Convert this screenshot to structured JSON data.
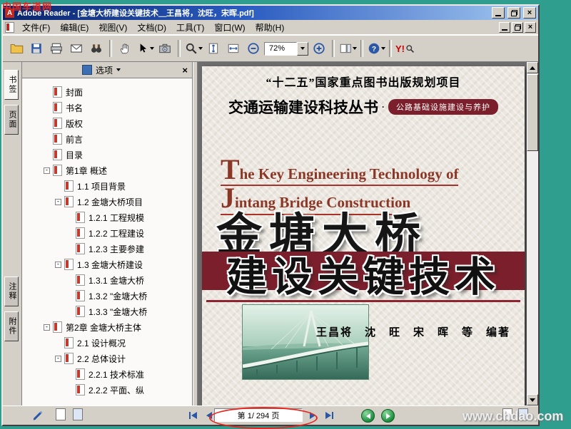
{
  "annotations": {
    "watermark_top": "中国车道网",
    "watermark_bottom": "www.chdao.com"
  },
  "titlebar": {
    "title": "Adobe Reader - [金塘大桥建设关键技术＿王昌将，沈旺，宋晖.pdf]"
  },
  "menubar": {
    "items": [
      {
        "id": "file",
        "label": "文件(F)"
      },
      {
        "id": "edit",
        "label": "编辑(E)"
      },
      {
        "id": "view",
        "label": "视图(V)"
      },
      {
        "id": "document",
        "label": "文档(D)"
      },
      {
        "id": "tools",
        "label": "工具(T)"
      },
      {
        "id": "window",
        "label": "窗口(W)"
      },
      {
        "id": "help",
        "label": "帮助(H)"
      }
    ]
  },
  "toolbar": {
    "zoom_value": "72%",
    "yahoo_label": "Y!",
    "icon_names": [
      "open-folder",
      "save-copy",
      "print",
      "email",
      "search-binoculars",
      "hand-tool",
      "select-tool",
      "snapshot-camera",
      "zoom-tool",
      "fit-page",
      "fit-width",
      "zoom-out",
      "zoom-in",
      "page-layout",
      "help",
      "yahoo-search"
    ]
  },
  "sidebar": {
    "header": {
      "options_label": "选项"
    },
    "tabs": [
      {
        "id": "bookmarks",
        "label": "书签",
        "active": true
      },
      {
        "id": "pages",
        "label": "页面",
        "active": false
      },
      {
        "id": "comments",
        "label": "注释",
        "active": false
      },
      {
        "id": "attachments",
        "label": "附件",
        "active": false
      }
    ],
    "bookmarks": [
      {
        "label": "封面",
        "level": 0,
        "expandable": false
      },
      {
        "label": "书名",
        "level": 0,
        "expandable": false
      },
      {
        "label": "版权",
        "level": 0,
        "expandable": false
      },
      {
        "label": "前言",
        "level": 0,
        "expandable": false
      },
      {
        "label": "目录",
        "level": 0,
        "expandable": false
      },
      {
        "label": "第1章 概述",
        "level": 0,
        "expandable": true
      },
      {
        "label": "1.1 项目背景",
        "level": 1,
        "expandable": false
      },
      {
        "label": "1.2 金塘大桥项目",
        "level": 1,
        "expandable": true
      },
      {
        "label": "1.2.1 工程规模",
        "level": 2,
        "expandable": false
      },
      {
        "label": "1.2.2 工程建设",
        "level": 2,
        "expandable": false
      },
      {
        "label": "1.2.3 主要参建",
        "level": 2,
        "expandable": false
      },
      {
        "label": "1.3 金塘大桥建设",
        "level": 1,
        "expandable": true
      },
      {
        "label": "1.3.1 金塘大桥",
        "level": 2,
        "expandable": false
      },
      {
        "label": "1.3.2 \"金塘大桥",
        "level": 2,
        "expandable": false
      },
      {
        "label": "1.3.3 \"金塘大桥",
        "level": 2,
        "expandable": false
      },
      {
        "label": "第2章 金塘大桥主体",
        "level": 0,
        "expandable": true
      },
      {
        "label": "2.1 设计概况",
        "level": 1,
        "expandable": false
      },
      {
        "label": "2.2 总体设计",
        "level": 1,
        "expandable": true
      },
      {
        "label": "2.2.1 技术标准",
        "level": 2,
        "expandable": false
      },
      {
        "label": "2.2.2 平面、纵",
        "level": 2,
        "expandable": false
      }
    ]
  },
  "document": {
    "page": {
      "project_line": "“十二五”国家重点图书出版规划项目",
      "series_title": "交通运输建设科技丛书",
      "series_dot": "·",
      "series_sub": "公路基础设施建设与养护",
      "english_title_line1": "The Key Engineering Technology of",
      "english_title_line2": "Jintang Bridge Construction",
      "main_title": "金塘大桥",
      "sub_title": "建设关键技术",
      "authors": "王昌将　沈　旺　宋　晖　等　编著"
    }
  },
  "statusbar": {
    "page_indicator": "第 1/ 294 页"
  }
}
